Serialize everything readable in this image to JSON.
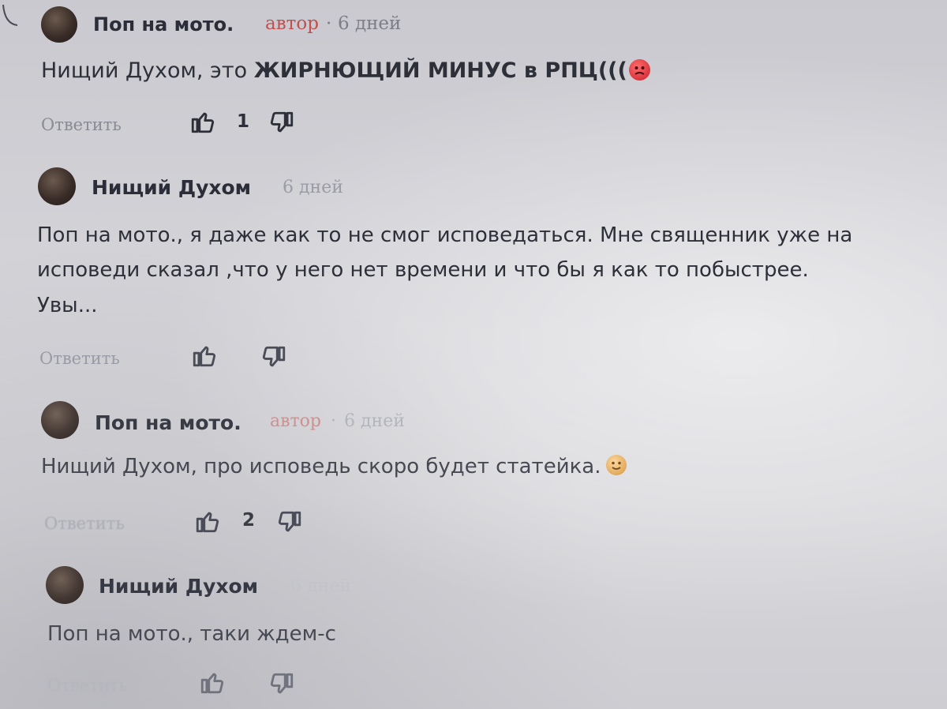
{
  "comments": [
    {
      "author": "Поп на мото.",
      "badge": "автор",
      "separator": "·",
      "time": "6 дней",
      "text_plain": "Нищий Духом, это ",
      "text_bold": "ЖИРНЮЩИЙ МИНУС в РПЦ(((",
      "emoji": "angry-face",
      "reply_label": "Ответить",
      "likes": "1"
    },
    {
      "author": "Нищий Духом",
      "time": "6 дней",
      "text_lines": [
        "Поп на мото., я даже как то не смог исповедаться. Мне священник уже на",
        "исповеди сказал ,что у него нет времени и что бы я как то побыстрее.",
        "Увы..."
      ],
      "reply_label": "Ответить"
    },
    {
      "author": "Поп на мото.",
      "badge": "автор",
      "separator": "·",
      "time": "6 дней",
      "text": "Нищий Духом, про исповедь скоро будет статейка.",
      "emoji": "smiling-face",
      "reply_label": "Ответить",
      "likes": "2"
    },
    {
      "author": "Нищий Духом",
      "time": "6 дней",
      "text": "Поп на мото., таки ждем-с",
      "reply_label": "Ответить"
    }
  ],
  "colors": {
    "badge": "#c0514f",
    "text": "#2e3039",
    "muted": "#8a8c95"
  }
}
